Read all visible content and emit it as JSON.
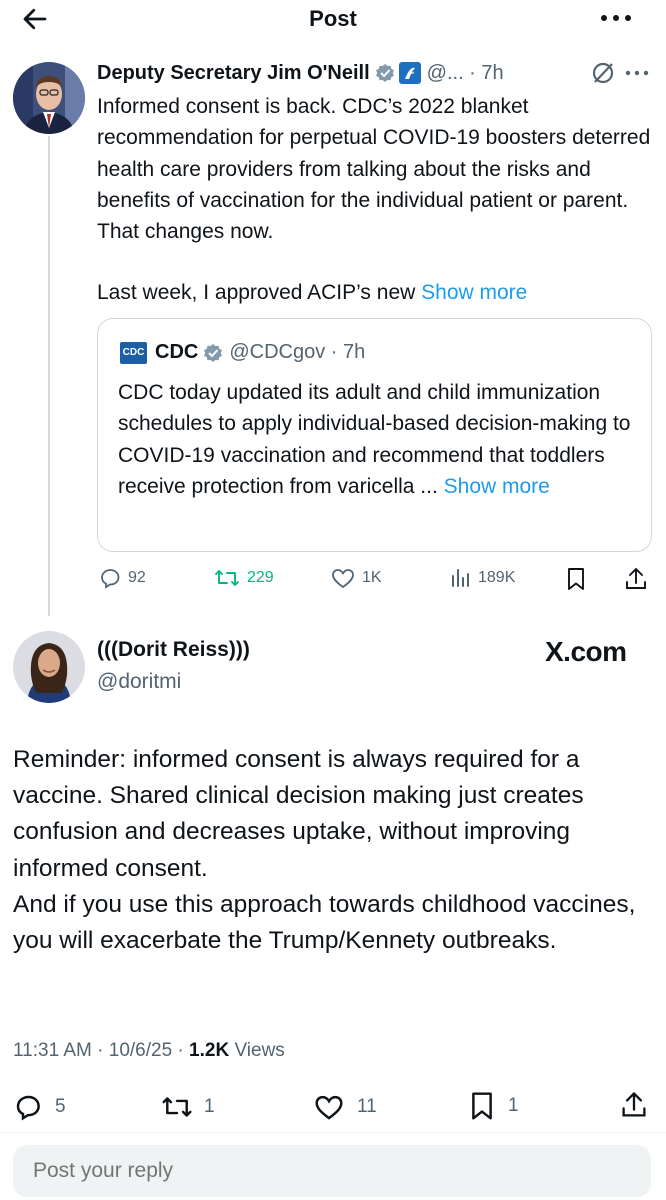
{
  "header": {
    "title": "Post",
    "back_icon": "arrow-left-icon",
    "more_icon": "more-horizontal-icon"
  },
  "tweet1": {
    "author_name": "Deputy Secretary Jim O'Neill",
    "meta": "@... · 7h",
    "text": "Informed consent is back. CDC’s 2022 blanket recommendation for perpetual COVID-19 boosters deterred health care providers from talking about the risks and benefits of vaccination for the individual patient or parent. That changes now.",
    "text2": "Last week, I approved ACIP’s new",
    "show_more": "Show more",
    "quote": {
      "logo_text": "CDC",
      "name": "CDC",
      "meta": "@CDCgov · 7h",
      "text": "CDC today updated its adult and child immunization schedules to apply individual-based decision-making to COVID-19 vaccination and recommend that toddlers receive protection from varicella ...",
      "show_more": "Show more"
    },
    "actions": {
      "replies": "92",
      "reposts": "229",
      "likes": "1K",
      "views": "189K"
    },
    "colors": {
      "repost": "#00ba7c",
      "link": "#1d9bf0",
      "verified": "#829aab",
      "gov": "#1d6fc0"
    }
  },
  "tweet2": {
    "author_name": "(((Dorit Reiss)))",
    "handle": "@doritmi",
    "brand": "X.com",
    "text": "Reminder: informed consent is always required for a vaccine. Shared clinical decision making just creates confusion and decreases uptake, without improving informed consent.\nAnd if you use this approach towards childhood vaccines, you will exacerbate the Trump/Kennety outbreaks.",
    "time": "11:31 AM · 10/6/25 · ",
    "views_count": "1.2K",
    "views_label": " Views",
    "actions": {
      "replies": "5",
      "reposts": "1",
      "likes": "11",
      "bookmarks": "1"
    }
  },
  "reply": {
    "placeholder": "Post your reply"
  }
}
